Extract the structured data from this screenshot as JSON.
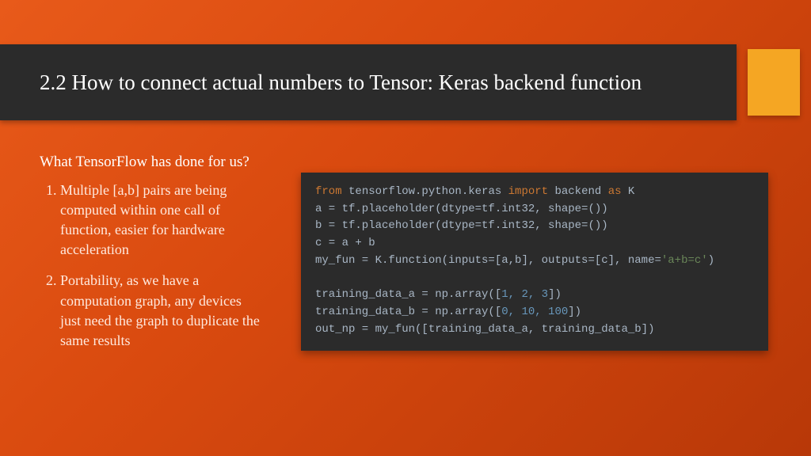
{
  "title": "2.2 How to connect actual numbers to Tensor: Keras backend function",
  "subhead": "What TensorFlow has done for us?",
  "bullets": [
    "Multiple [a,b] pairs are being computed within one call of function, easier for hardware acceleration",
    "Portability, as we have a computation graph, any devices just need the graph to duplicate the same results"
  ],
  "code": {
    "l1_from": "from",
    "l1_pkg": " tensorflow.python.keras ",
    "l1_import": "import",
    "l1_back": " backend ",
    "l1_as": "as",
    "l1_k": " K",
    "l2": "a = tf.placeholder(dtype=tf.int32, shape=())",
    "l3": "b = tf.placeholder(dtype=tf.int32, shape=())",
    "l4": "c = a + b",
    "l5a": "my_fun = K.function(inputs=[a,b], outputs=[c], name=",
    "l5s": "'a+b=c'",
    "l5b": ")",
    "l6": "",
    "l7a": "training_data_a = np.array([",
    "l7n": "1, 2, 3",
    "l7b": "])",
    "l8a": "training_data_b = np.array([",
    "l8n": "0, 10, 100",
    "l8b": "])",
    "l9": "out_np = my_fun([training_data_a, training_data_b])"
  }
}
